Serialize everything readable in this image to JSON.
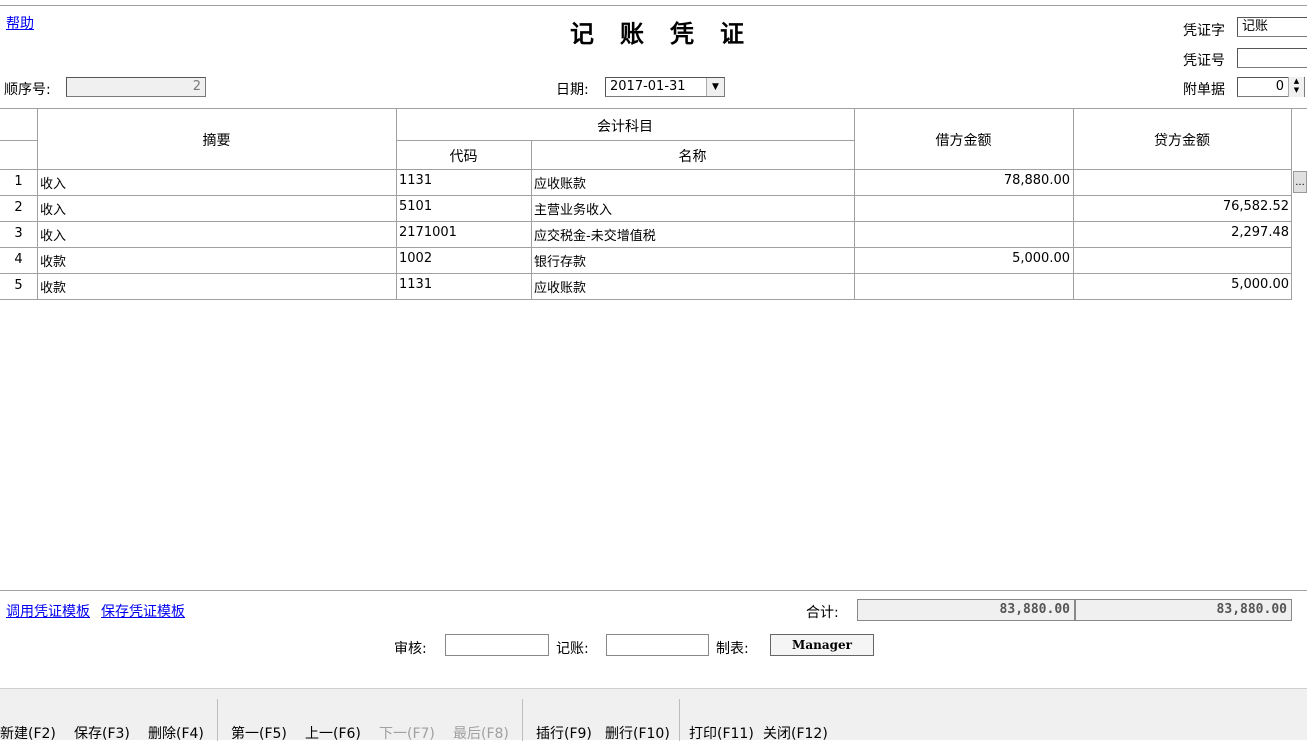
{
  "header": {
    "help": "帮助",
    "title": "记账凭证",
    "seq_label": "顺序号:",
    "seq_value": "2",
    "date_label": "日期:",
    "date_value": "2017-01-31",
    "voucher_word_label": "凭证字",
    "voucher_word_value": "记账",
    "voucher_no_label": "凭证号",
    "voucher_no_value": "",
    "attach_label": "附单据",
    "attach_value": "0"
  },
  "grid": {
    "headers": {
      "summary": "摘要",
      "account": "会计科目",
      "code": "代码",
      "name": "名称",
      "debit": "借方金额",
      "credit": "贷方金额"
    },
    "rows": [
      {
        "no": "1",
        "summary": "收入",
        "code": "1131",
        "name": "应收账款",
        "debit": "78,880.00",
        "credit": ""
      },
      {
        "no": "2",
        "summary": "收入",
        "code": "5101",
        "name": "主营业务收入",
        "debit": "",
        "credit": "76,582.52"
      },
      {
        "no": "3",
        "summary": "收入",
        "code": "2171001",
        "name": "应交税金-未交增值税",
        "debit": "",
        "credit": "2,297.48"
      },
      {
        "no": "4",
        "summary": "收款",
        "code": "1002",
        "name": "银行存款",
        "debit": "5,000.00",
        "credit": ""
      },
      {
        "no": "5",
        "summary": "收款",
        "code": "1131",
        "name": "应收账款",
        "debit": "",
        "credit": "5,000.00"
      }
    ],
    "row_button": "..."
  },
  "footer": {
    "use_template": "调用凭证模板",
    "save_template": "保存凭证模板",
    "total_label": "合计:",
    "total_debit": "83,880.00",
    "total_credit": "83,880.00",
    "audit_label": "审核:",
    "post_label": "记账:",
    "maker_label": "制表:",
    "maker_value": "Manager"
  },
  "toolbar": {
    "new": "新建(F2)",
    "save": "保存(F3)",
    "delete": "删除(F4)",
    "first": "第一(F5)",
    "prev": "上一(F6)",
    "next": "下一(F7)",
    "last": "最后(F8)",
    "insert_row": "插行(F9)",
    "delete_row": "删行(F10)",
    "print": "打印(F11)",
    "close": "关闭(F12)"
  }
}
